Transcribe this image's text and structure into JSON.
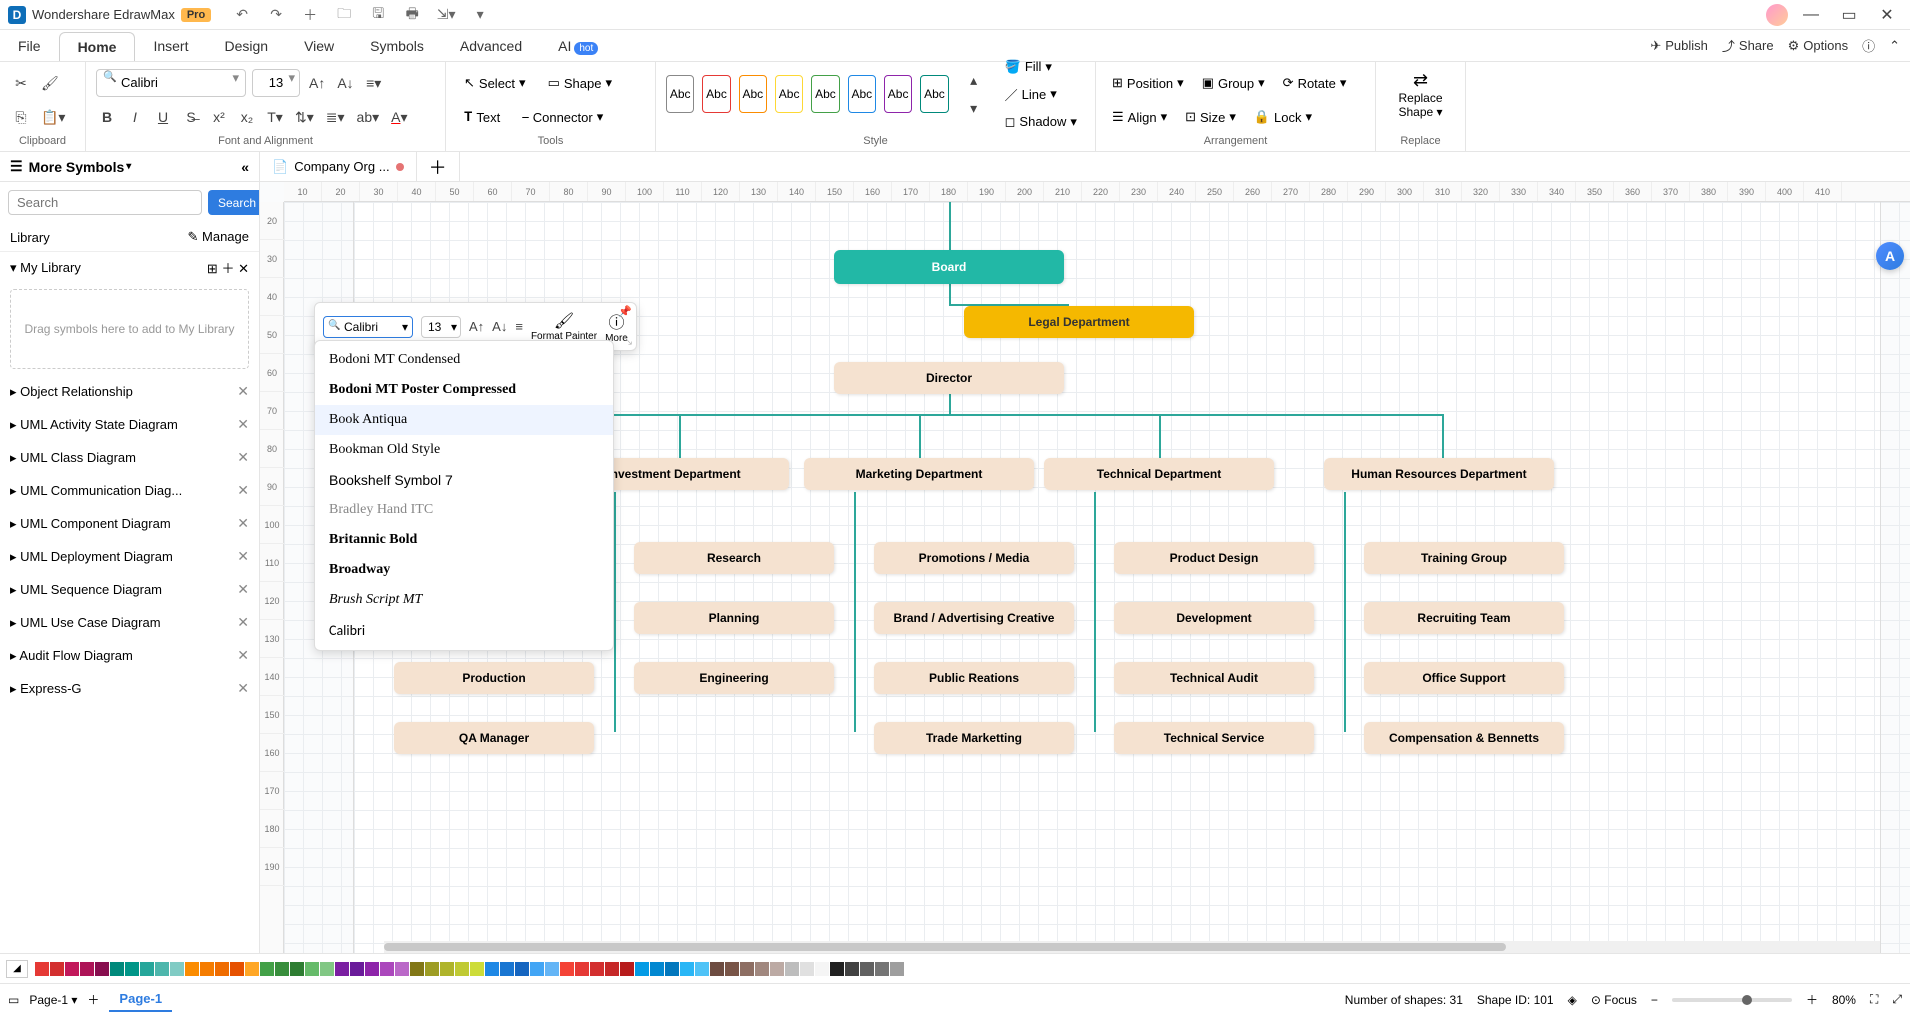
{
  "app": {
    "title": "Wondershare EdrawMax",
    "badge": "Pro"
  },
  "menubar": {
    "items": [
      "File",
      "Home",
      "Insert",
      "Design",
      "View",
      "Symbols",
      "Advanced",
      "AI"
    ],
    "active": "Home",
    "hot": "hot",
    "right": {
      "publish": "Publish",
      "share": "Share",
      "options": "Options"
    }
  },
  "ribbon": {
    "clipboard": {
      "label": "Clipboard"
    },
    "font": {
      "family": "Calibri",
      "size": "13",
      "label": "Font and Alignment"
    },
    "tools": {
      "select": "Select",
      "text": "Text",
      "shape": "Shape",
      "connector": "Connector",
      "label": "Tools"
    },
    "style": {
      "abc": "Abc",
      "fill": "Fill",
      "line": "Line",
      "shadow": "Shadow",
      "label": "Style"
    },
    "arr": {
      "position": "Position",
      "align": "Align",
      "group": "Group",
      "size": "Size",
      "rotate": "Rotate",
      "lock": "Lock",
      "label": "Arrangement"
    },
    "replace": {
      "l1": "Replace",
      "l2": "Shape",
      "label": "Replace"
    }
  },
  "doctab": {
    "name": "Company Org ..."
  },
  "sidebar": {
    "title": "More Symbols",
    "search_ph": "Search",
    "search_btn": "Search",
    "library": "Library",
    "manage": "Manage",
    "mylib": "My Library",
    "drag": "Drag symbols here to add to My Library",
    "cats": [
      "Object Relationship",
      "UML Activity State Diagram",
      "UML Class Diagram",
      "UML Communication Diag...",
      "UML Component Diagram",
      "UML Deployment Diagram",
      "UML Sequence Diagram",
      "UML Use Case Diagram",
      "Audit Flow Diagram",
      "Express-G"
    ]
  },
  "ruler_h": [
    "10",
    "20",
    "30",
    "40",
    "50",
    "60",
    "70",
    "80",
    "90",
    "100",
    "110",
    "120",
    "130",
    "140",
    "150",
    "160",
    "170",
    "180",
    "190",
    "200",
    "210",
    "220",
    "230",
    "240",
    "250",
    "260",
    "270",
    "280",
    "290",
    "300",
    "310",
    "320",
    "330",
    "340",
    "350",
    "360",
    "370",
    "380",
    "390",
    "400",
    "410"
  ],
  "ruler_v": [
    "20",
    "30",
    "40",
    "50",
    "60",
    "70",
    "80",
    "90",
    "100",
    "110",
    "120",
    "130",
    "140",
    "150",
    "160",
    "170",
    "180",
    "190"
  ],
  "float": {
    "font": "Calibri",
    "size": "13",
    "format": "Format Painter",
    "more": "More",
    "fonts": [
      "Bodoni MT Condensed",
      "Bodoni MT Poster Compressed",
      "Book Antiqua",
      "Bookman Old Style",
      "Bookshelf Symbol 7",
      "Bradley Hand ITC",
      "Britannic Bold",
      "Broadway",
      "Brush Script MT",
      "Calibri"
    ]
  },
  "chart": {
    "board": "Board",
    "legal": "Legal  Department",
    "director": "Director",
    "depts": [
      "Investment Department",
      "Marketing Department",
      "Technical Department",
      "Human Resources Department"
    ],
    "col_inv": [
      "Research",
      "Planning",
      "Engineering"
    ],
    "col_mkt": [
      "Promotions / Media",
      "Brand / Advertising Creative",
      "Public Reations",
      "Trade Marketting"
    ],
    "col_tech": [
      "Product Design",
      "Development",
      "Technical Audit",
      "Technical Service"
    ],
    "col_hr": [
      "Training Group",
      "Recruiting Team",
      "Office Support",
      "Compensation & Bennetts"
    ],
    "col_prod": [
      "Production",
      "QA Manager"
    ]
  },
  "palette": [
    "#e53935",
    "#d32f2f",
    "#c2185b",
    "#ad1457",
    "#880e4f",
    "#00897b",
    "#009688",
    "#26a69a",
    "#4db6ac",
    "#80cbc4",
    "#fb8c00",
    "#f57c00",
    "#ef6c00",
    "#e65100",
    "#ffa726",
    "#43a047",
    "#388e3c",
    "#2e7d32",
    "#66bb6a",
    "#81c784",
    "#7b1fa2",
    "#6a1b9a",
    "#8e24aa",
    "#ab47bc",
    "#ba68c8",
    "#827717",
    "#9e9d24",
    "#afb42b",
    "#c0ca33",
    "#cddc39",
    "#1e88e5",
    "#1976d2",
    "#1565c0",
    "#42a5f5",
    "#64b5f6",
    "#f44336",
    "#e53935",
    "#d32f2f",
    "#c62828",
    "#b71c1c",
    "#039be5",
    "#0288d1",
    "#0277bd",
    "#29b6f6",
    "#4fc3f7",
    "#6d4c41",
    "#795548",
    "#8d6e63",
    "#a1887f",
    "#bcaaa4",
    "#bdbdbd",
    "#e0e0e0",
    "#f5f5f5",
    "#212121",
    "#424242",
    "#616161",
    "#757575",
    "#9e9e9e"
  ],
  "status": {
    "page_sel": "Page-1",
    "page_tab": "Page-1",
    "shapes": "Number of shapes: 31",
    "shape_id": "Shape ID: 101",
    "focus": "Focus",
    "zoom": "80%"
  }
}
